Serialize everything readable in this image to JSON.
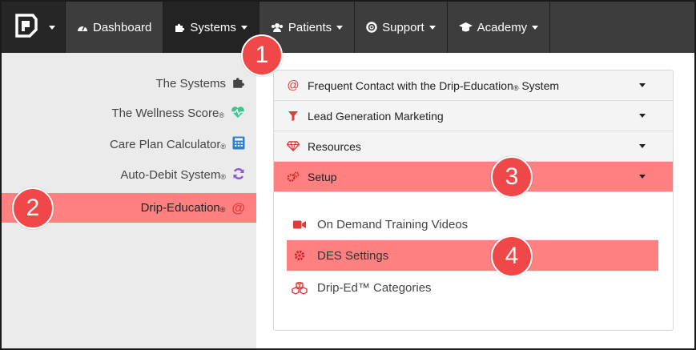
{
  "nav": {
    "items": [
      {
        "label": "Dashboard",
        "icon": "dashboard-icon",
        "dropdown": false
      },
      {
        "label": "Systems",
        "icon": "puzzle-icon",
        "dropdown": true,
        "active": true
      },
      {
        "label": "Patients",
        "icon": "users-icon",
        "dropdown": true
      },
      {
        "label": "Support",
        "icon": "life-ring-icon",
        "dropdown": true
      },
      {
        "label": "Academy",
        "icon": "graduation-cap-icon",
        "dropdown": true
      }
    ]
  },
  "sidebar": {
    "items": [
      {
        "label": "The Systems",
        "reg": "",
        "icon": "puzzle-icon"
      },
      {
        "label": "The Wellness Score",
        "reg": "®",
        "icon": "heartbeat-icon"
      },
      {
        "label": "Care Plan Calculator",
        "reg": "®",
        "icon": "calculator-icon"
      },
      {
        "label": "Auto-Debit System",
        "reg": "®",
        "icon": "refresh-icon"
      },
      {
        "label": "Drip-Education",
        "reg": "®",
        "icon": "at-icon",
        "active": true
      }
    ]
  },
  "accordion": {
    "sections": [
      {
        "label": "Frequent Contact with the Drip-Education",
        "reg": "®",
        "suffix": " System",
        "icon": "at-icon"
      },
      {
        "label": "Lead Generation Marketing",
        "reg": "",
        "suffix": "",
        "icon": "filter-icon"
      },
      {
        "label": "Resources",
        "reg": "",
        "suffix": "",
        "icon": "diamond-icon"
      },
      {
        "label": "Setup",
        "reg": "",
        "suffix": "",
        "icon": "cogs-icon",
        "active": true
      }
    ],
    "setup_items": [
      {
        "label": "On Demand Training Videos",
        "icon": "video-camera-icon"
      },
      {
        "label": "DES Settings",
        "icon": "cog-icon",
        "active": true
      },
      {
        "label": "Drip-Ed™ Categories",
        "icon": "cubes-icon"
      }
    ]
  },
  "callouts": [
    "1",
    "2",
    "3",
    "4"
  ],
  "colors": {
    "nav_bg": "#3d3d3d",
    "highlight": "#ff8080",
    "accent_red": "#e03a3a",
    "badge": "#f04848",
    "wellness_green": "#3cc48c",
    "calculator_blue": "#2a7fd4",
    "refresh_purple": "#8e5ac8"
  }
}
